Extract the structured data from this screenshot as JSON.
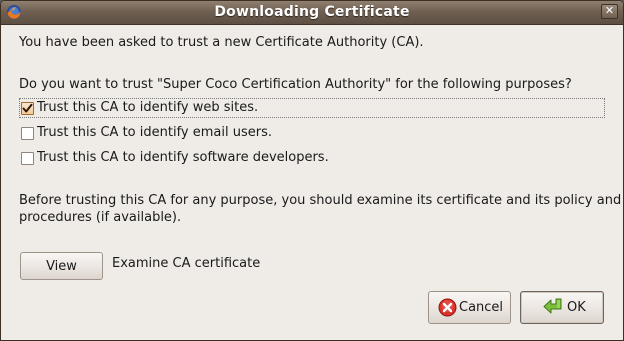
{
  "window": {
    "title": "Downloading Certificate"
  },
  "dialog": {
    "intro": "You have been asked to trust a new Certificate Authority (CA).",
    "question": "Do you want to trust \"Super Coco Certification Authority\" for the following purposes?",
    "options": [
      {
        "label": "Trust this CA to identify web sites.",
        "checked": true
      },
      {
        "label": "Trust this CA to identify email users.",
        "checked": false
      },
      {
        "label": "Trust this CA to identify software developers.",
        "checked": false
      }
    ],
    "advice_line1": "Before trusting this CA for any purpose, you should examine its certificate and its policy and",
    "advice_line2": "procedures (if available).",
    "view_button": "View",
    "view_caption": "Examine CA certificate"
  },
  "buttons": {
    "cancel": "Cancel",
    "ok": "OK"
  },
  "icons": {
    "app": "firefox-icon",
    "close": "close-icon",
    "cancel": "cancel-icon",
    "ok": "ok-arrow-icon"
  },
  "colors": {
    "titlebar": "#6f6052",
    "background": "#efebe7",
    "checkbox_checked": "#f5c996"
  }
}
